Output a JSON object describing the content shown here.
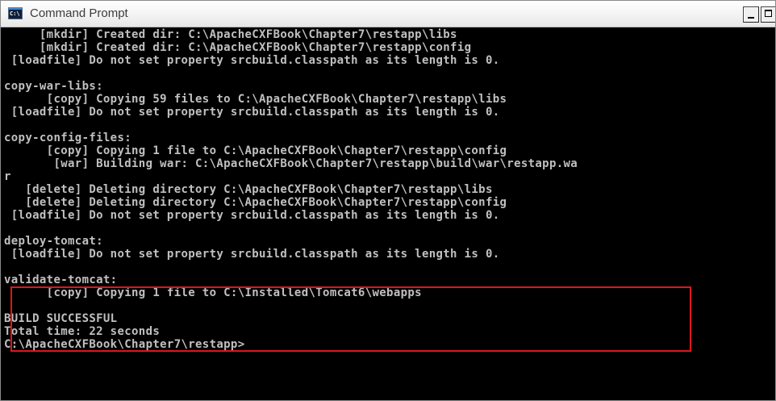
{
  "window": {
    "title": "Command Prompt",
    "icon": "cmd-console-icon",
    "icon_glyph": "C:\\",
    "buttons": [
      "minimize",
      "maximize"
    ]
  },
  "console": {
    "lines": [
      "     [mkdir] Created dir: C:\\ApacheCXFBook\\Chapter7\\restapp\\libs",
      "     [mkdir] Created dir: C:\\ApacheCXFBook\\Chapter7\\restapp\\config",
      " [loadfile] Do not set property srcbuild.classpath as its length is 0.",
      "",
      "copy-war-libs:",
      "      [copy] Copying 59 files to C:\\ApacheCXFBook\\Chapter7\\restapp\\libs",
      " [loadfile] Do not set property srcbuild.classpath as its length is 0.",
      "",
      "copy-config-files:",
      "      [copy] Copying 1 file to C:\\ApacheCXFBook\\Chapter7\\restapp\\config",
      "       [war] Building war: C:\\ApacheCXFBook\\Chapter7\\restapp\\build\\war\\restapp.wa",
      "r",
      "   [delete] Deleting directory C:\\ApacheCXFBook\\Chapter7\\restapp\\libs",
      "   [delete] Deleting directory C:\\ApacheCXFBook\\Chapter7\\restapp\\config",
      " [loadfile] Do not set property srcbuild.classpath as its length is 0.",
      "",
      "deploy-tomcat:",
      " [loadfile] Do not set property srcbuild.classpath as its length is 0.",
      "",
      "validate-tomcat:",
      "      [copy] Copying 1 file to C:\\Installed\\Tomcat6\\webapps",
      "",
      "BUILD SUCCESSFUL",
      "Total time: 22 seconds",
      "C:\\ApacheCXFBook\\Chapter7\\restapp>"
    ],
    "text_color": "#c0c0c0",
    "background_color": "#000000",
    "highlight_color": "#e0161c"
  }
}
